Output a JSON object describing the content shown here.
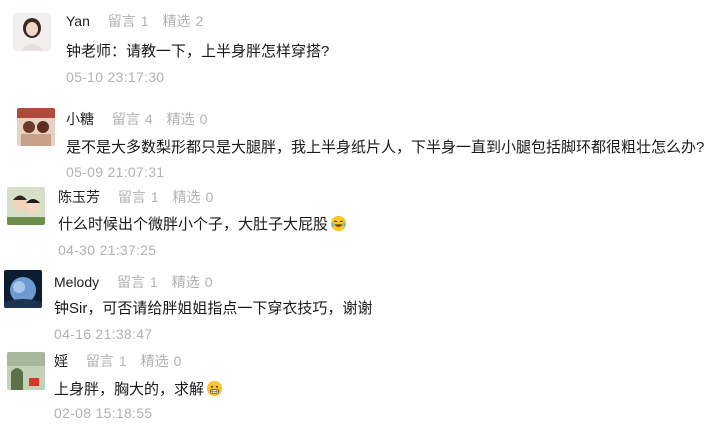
{
  "stats": {
    "reply_label": "留言",
    "select_label": "精选"
  },
  "comments": [
    {
      "name": "Yan",
      "reply_count": "1",
      "select_count": "2",
      "text": "钟老师：请教一下，上半身胖怎样穿搭?",
      "time": "05-10 23:17:30"
    },
    {
      "name": "小糖",
      "reply_count": "4",
      "select_count": "0",
      "text": "是不是大多数梨形都只是大腿胖，我上半身纸片人，下半身一直到小腿包括脚环都很粗壮怎么办?",
      "time": "05-09 21:07:31"
    },
    {
      "name": "陈玉芳",
      "reply_count": "1",
      "select_count": "0",
      "text": "什么时候出个微胖小个子，大肚子大屁股",
      "emoji": "tears-of-joy-emoji",
      "time": "04-30 21:37:25"
    },
    {
      "name": "Melody",
      "reply_count": "1",
      "select_count": "0",
      "text": "钟Sir，可否请给胖姐姐指点一下穿衣技巧，谢谢",
      "time": "04-16 21:38:47"
    },
    {
      "name": "婬",
      "reply_count": "1",
      "select_count": "0",
      "text": "上身胖，胸大的，求解",
      "emoji": "grimacing-emoji",
      "time": "02-08 15:18:55"
    }
  ]
}
